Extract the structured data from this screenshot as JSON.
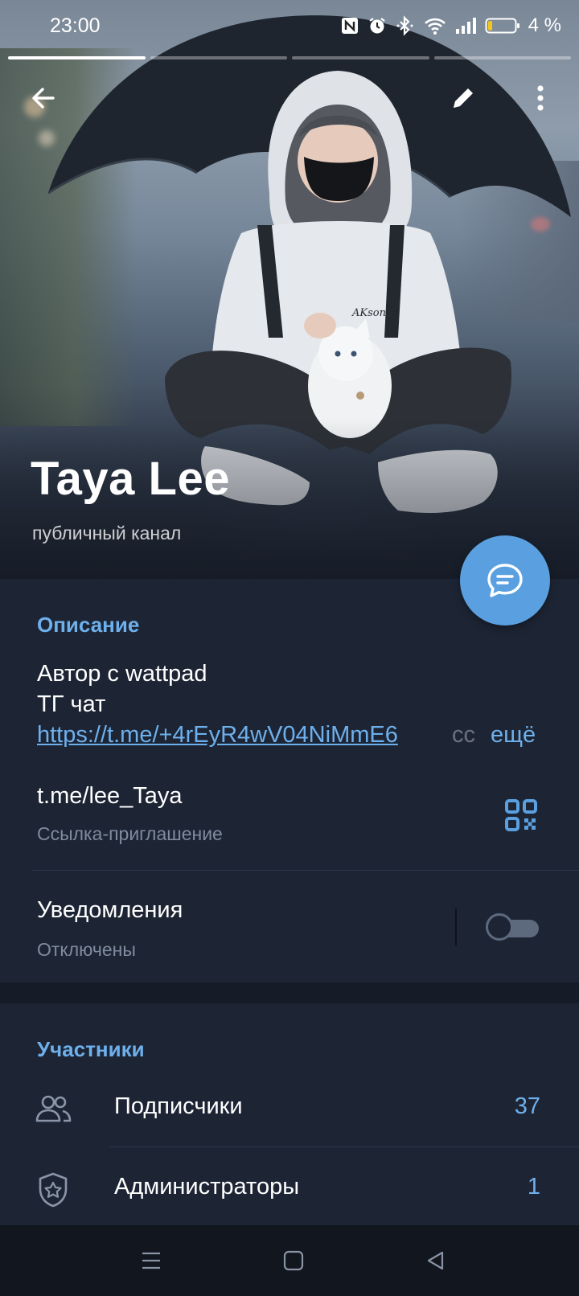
{
  "status_bar": {
    "time": "23:00",
    "battery_percent": "4 %",
    "icons": [
      "nfc-icon",
      "alarm-icon",
      "bluetooth-icon",
      "wifi-icon",
      "signal-icon",
      "battery-icon"
    ]
  },
  "story_progress": {
    "segments": 4,
    "active_index": 0
  },
  "header": {
    "back_icon": "arrow-left-icon",
    "edit_icon": "pencil-icon",
    "menu_icon": "more-vertical-icon",
    "channel_name": "Taya Lee",
    "channel_type": "публичный канал",
    "fab_icon": "chat-bubble-icon"
  },
  "description": {
    "section_title": "Описание",
    "line1": "Автор с wattpad",
    "line2": "ТГ чат",
    "link": "https://t.me/+4rEyR4wV04NiMmE6",
    "truncated_tail": "сс",
    "more_label": "ещё"
  },
  "invite": {
    "link": "t.me/lee_Taya",
    "label": "Ссылка-приглашение",
    "qr_icon": "qr-code-icon"
  },
  "notifications": {
    "title": "Уведомления",
    "state": "Отключены",
    "enabled": false
  },
  "members": {
    "section_title": "Участники",
    "items": [
      {
        "icon": "users-icon",
        "label": "Подписчики",
        "count": "37"
      },
      {
        "icon": "shield-star-icon",
        "label": "Администраторы",
        "count": "1"
      }
    ]
  },
  "colors": {
    "background": "#1d2535",
    "accent": "#6eb0ec",
    "fab": "#5aa0e0",
    "secondary_text": "#7f8b9e",
    "navbar": "#11161f"
  }
}
